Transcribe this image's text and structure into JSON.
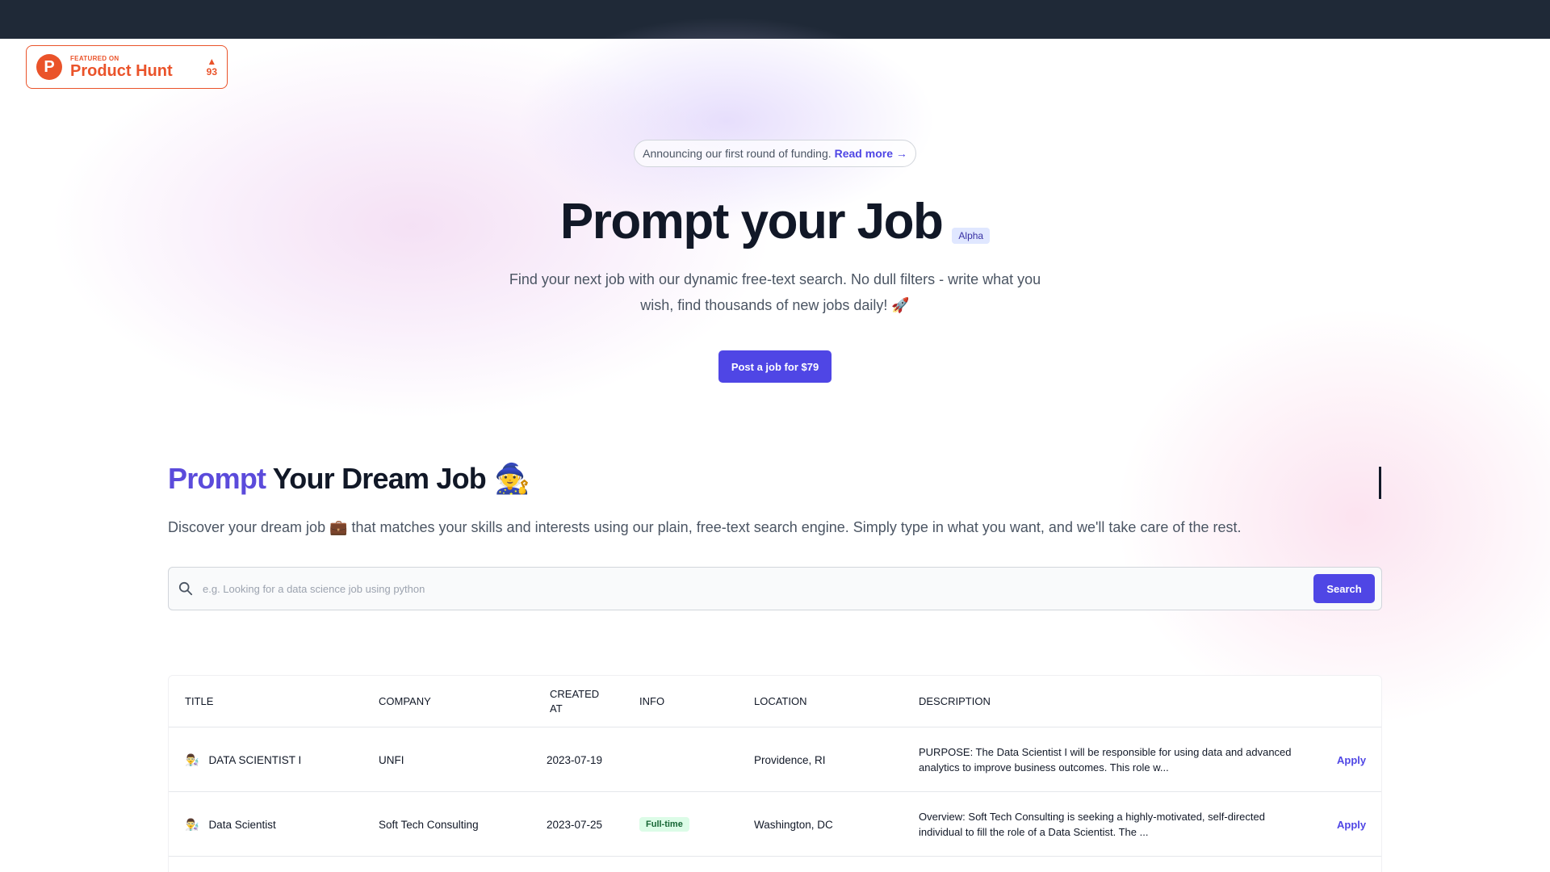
{
  "product_hunt": {
    "featured": "FEATURED ON",
    "name": "Product Hunt",
    "logo_letter": "P",
    "arrow": "▲",
    "votes": "93"
  },
  "announcement": {
    "text": "Announcing our first round of funding.",
    "link": "Read more →"
  },
  "hero": {
    "title": "Prompt your Job",
    "badge": "Alpha",
    "subtitle": "Find your next job with our dynamic free-text search. No dull filters - write what you wish, find thousands of new jobs daily! 🚀",
    "post_button": "Post a job for $79"
  },
  "section": {
    "title_accent": "Prompt",
    "title_rest": "Your Dream Job",
    "title_emoji": "🧙",
    "description": "Discover your dream job 💼 that matches your skills and interests using our plain, free-text search engine. Simply type in what you want, and we'll take care of the rest."
  },
  "search": {
    "placeholder": "e.g. Looking for a data science job using python",
    "value": "",
    "button": "Search"
  },
  "table": {
    "headers": {
      "title": "TITLE",
      "company": "COMPANY",
      "created_at": "CREATED AT",
      "info": "INFO",
      "location": "LOCATION",
      "description": "DESCRIPTION"
    },
    "rows": [
      {
        "emoji": "👨‍🔬",
        "title": "DATA SCIENTIST I",
        "company": "UNFI",
        "created_at": "2023-07-19",
        "info": "",
        "location": "Providence, RI",
        "description": "PURPOSE: The Data Scientist I will be responsible for using data and advanced analytics to improve business outcomes. This role w...",
        "action": "Apply"
      },
      {
        "emoji": "👨‍🔬",
        "title": "Data Scientist",
        "company": "Soft Tech Consulting",
        "created_at": "2023-07-25",
        "info": "Full-time",
        "location": "Washington, DC",
        "description": "Overview: Soft Tech Consulting is seeking a highly-motivated, self-directed individual to fill the role of a Data Scientist. The ...",
        "action": "Apply"
      }
    ]
  }
}
